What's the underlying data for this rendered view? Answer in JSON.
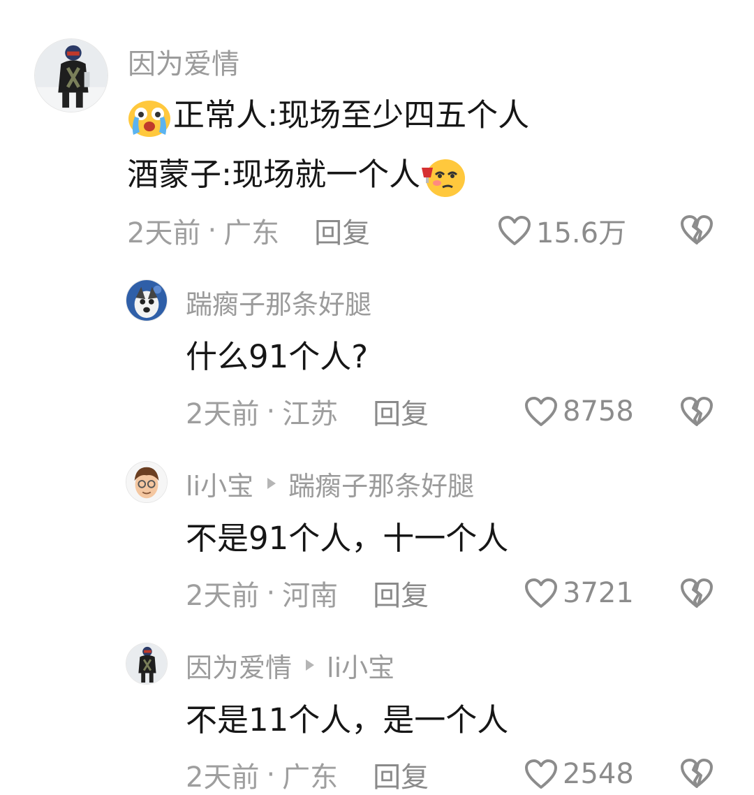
{
  "comments": [
    {
      "username": "因为爱情",
      "lines": [
        "正常人:现场至少四五个人",
        "酒蒙子:现场就一个人"
      ],
      "time": "2天前",
      "location": "广东",
      "reply_label": "回复",
      "likes": "15.6万"
    },
    {
      "username": "踹瘸子那条好腿",
      "content": "什么91个人?",
      "time": "2天前",
      "location": "江苏",
      "reply_label": "回复",
      "likes": "8758"
    },
    {
      "username": "li小宝",
      "reply_to": "踹瘸子那条好腿",
      "content": "不是91个人，十一个人",
      "time": "2天前",
      "location": "河南",
      "reply_label": "回复",
      "likes": "3721"
    },
    {
      "username": "因为爱情",
      "reply_to": "li小宝",
      "content": "不是11个人，是一个人",
      "time": "2天前",
      "location": "广东",
      "reply_label": "回复",
      "likes": "2548"
    }
  ],
  "meta_separator": "·",
  "icons": {
    "like": "heart-outline-icon",
    "dislike": "broken-heart-icon",
    "emoji_1": "crying-face-emoji",
    "emoji_2": "tipsy-face-emoji"
  },
  "colors": {
    "username": "#9b9b9b",
    "content": "#161616",
    "meta": "#9e9e9e",
    "icon": "#8c8c8c"
  }
}
